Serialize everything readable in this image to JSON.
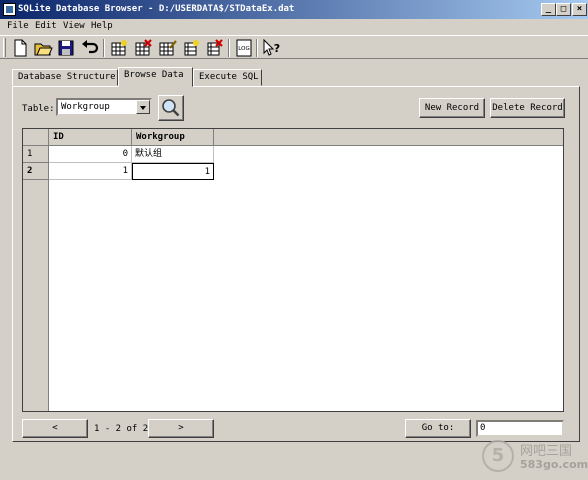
{
  "window": {
    "title": "SQLite Database Browser - D:/USERDATA$/STDataEx.dat",
    "controls": {
      "minimize": "_",
      "maximize": "□",
      "close": "×"
    }
  },
  "menu": [
    "File",
    "Edit",
    "View",
    "Help"
  ],
  "toolbar": {
    "icons": [
      "new-database-icon",
      "open-database-icon",
      "save-icon",
      "undo-icon",
      "create-table-icon",
      "delete-table-icon",
      "modify-table-icon",
      "create-index-icon",
      "delete-index-icon",
      "sql-log-icon",
      "whats-this-icon"
    ],
    "log_icon_text": "LOG",
    "help_icon_text": "?"
  },
  "tabs": [
    "Database Structure",
    "Browse Data",
    "Execute SQL"
  ],
  "active_tab": "Browse Data",
  "browse": {
    "table_label": "Table:",
    "table_selected": "Workgroup",
    "new_record_label": "New Record",
    "delete_record_label": "Delete Record",
    "columns": [
      "ID",
      "Workgroup"
    ],
    "rows": [
      {
        "row_num": "1",
        "cells": [
          "0",
          "默认组"
        ]
      },
      {
        "row_num": "2",
        "cells": [
          "1",
          "1"
        ]
      }
    ],
    "current_row_num": "2",
    "prev_label": "<",
    "next_label": ">",
    "range_text": "1 - 2 of 2",
    "goto_label": "Go to:",
    "goto_value": "0"
  },
  "watermark": {
    "circle_text": "5",
    "name": "网吧三国",
    "site": "583go.com"
  }
}
